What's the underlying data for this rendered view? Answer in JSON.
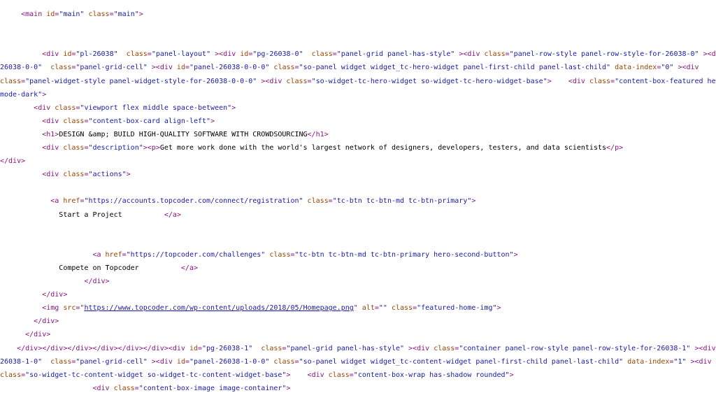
{
  "lines": [
    {
      "indent": "     ",
      "parts": [
        {
          "c": "tag",
          "t": "<main "
        },
        {
          "c": "attr",
          "t": "id"
        },
        {
          "c": "tag",
          "t": "="
        },
        {
          "c": "val",
          "t": "\"main\""
        },
        {
          "c": "tag",
          "t": " "
        },
        {
          "c": "attr",
          "t": "class"
        },
        {
          "c": "tag",
          "t": "="
        },
        {
          "c": "val",
          "t": "\"main\""
        },
        {
          "c": "tag",
          "t": ">"
        }
      ]
    },
    {
      "indent": "",
      "parts": []
    },
    {
      "indent": "",
      "parts": []
    },
    {
      "indent": "          ",
      "parts": [
        {
          "c": "tag",
          "t": "<div "
        },
        {
          "c": "attr",
          "t": "id"
        },
        {
          "c": "tag",
          "t": "="
        },
        {
          "c": "val",
          "t": "\"pl-26038\""
        },
        {
          "c": "tag",
          "t": "  "
        },
        {
          "c": "attr",
          "t": "class"
        },
        {
          "c": "tag",
          "t": "="
        },
        {
          "c": "val",
          "t": "\"panel-layout\""
        },
        {
          "c": "tag",
          "t": " ><div "
        },
        {
          "c": "attr",
          "t": "id"
        },
        {
          "c": "tag",
          "t": "="
        },
        {
          "c": "val",
          "t": "\"pg-26038-0\""
        },
        {
          "c": "tag",
          "t": "  "
        },
        {
          "c": "attr",
          "t": "class"
        },
        {
          "c": "tag",
          "t": "="
        },
        {
          "c": "val",
          "t": "\"panel-grid panel-has-style\""
        },
        {
          "c": "tag",
          "t": " ><div "
        },
        {
          "c": "attr",
          "t": "class"
        },
        {
          "c": "tag",
          "t": "="
        },
        {
          "c": "val",
          "t": "\"panel-row-style panel-row-style-for-26038-0\""
        },
        {
          "c": "tag",
          "t": " ><div "
        },
        {
          "c": "attr",
          "t": "id"
        },
        {
          "c": "tag",
          "t": "="
        },
        {
          "c": "val",
          "t": "\"pgc-"
        }
      ]
    },
    {
      "indent": "",
      "parts": [
        {
          "c": "val",
          "t": "26038-0-0\""
        },
        {
          "c": "tag",
          "t": "  "
        },
        {
          "c": "attr",
          "t": "class"
        },
        {
          "c": "tag",
          "t": "="
        },
        {
          "c": "val",
          "t": "\"panel-grid-cell\""
        },
        {
          "c": "tag",
          "t": " ><div "
        },
        {
          "c": "attr",
          "t": "id"
        },
        {
          "c": "tag",
          "t": "="
        },
        {
          "c": "val",
          "t": "\"panel-26038-0-0-0\""
        },
        {
          "c": "tag",
          "t": " "
        },
        {
          "c": "attr",
          "t": "class"
        },
        {
          "c": "tag",
          "t": "="
        },
        {
          "c": "val",
          "t": "\"so-panel widget widget_tc-hero-widget panel-first-child panel-last-child\""
        },
        {
          "c": "tag",
          "t": " "
        },
        {
          "c": "attr",
          "t": "data-index"
        },
        {
          "c": "tag",
          "t": "="
        },
        {
          "c": "val",
          "t": "\"0\""
        },
        {
          "c": "tag",
          "t": " ><div"
        }
      ]
    },
    {
      "indent": "",
      "parts": [
        {
          "c": "attr",
          "t": "class"
        },
        {
          "c": "tag",
          "t": "="
        },
        {
          "c": "val",
          "t": "\"panel-widget-style panel-widget-style-for-26038-0-0-0\""
        },
        {
          "c": "tag",
          "t": " ><div "
        },
        {
          "c": "attr",
          "t": "class"
        },
        {
          "c": "tag",
          "t": "="
        },
        {
          "c": "val",
          "t": "\"so-widget-tc-hero-widget so-widget-tc-hero-widget-base\""
        },
        {
          "c": "tag",
          "t": ">"
        },
        {
          "c": "txt",
          "t": "    "
        },
        {
          "c": "tag",
          "t": "<div "
        },
        {
          "c": "attr",
          "t": "class"
        },
        {
          "c": "tag",
          "t": "="
        },
        {
          "c": "val",
          "t": "\"content-box-featured hero bg-"
        }
      ]
    },
    {
      "indent": "",
      "parts": [
        {
          "c": "val",
          "t": "mode-dark\""
        },
        {
          "c": "tag",
          "t": ">"
        }
      ]
    },
    {
      "indent": "        ",
      "parts": [
        {
          "c": "tag",
          "t": "<div "
        },
        {
          "c": "attr",
          "t": "class"
        },
        {
          "c": "tag",
          "t": "="
        },
        {
          "c": "val",
          "t": "\"viewport flex middle space-between\""
        },
        {
          "c": "tag",
          "t": ">"
        }
      ]
    },
    {
      "indent": "          ",
      "parts": [
        {
          "c": "tag",
          "t": "<div "
        },
        {
          "c": "attr",
          "t": "class"
        },
        {
          "c": "tag",
          "t": "="
        },
        {
          "c": "val",
          "t": "\"content-box-card align-left\""
        },
        {
          "c": "tag",
          "t": ">"
        }
      ]
    },
    {
      "indent": "          ",
      "parts": [
        {
          "c": "tag",
          "t": "<h1>"
        },
        {
          "c": "txt",
          "t": "DESIGN &amp; BUILD HIGH-QUALITY SOFTWARE WITH CROWDSOURCING"
        },
        {
          "c": "tag",
          "t": "</h1>"
        }
      ]
    },
    {
      "indent": "          ",
      "parts": [
        {
          "c": "tag",
          "t": "<div "
        },
        {
          "c": "attr",
          "t": "class"
        },
        {
          "c": "tag",
          "t": "="
        },
        {
          "c": "val",
          "t": "\"description\""
        },
        {
          "c": "tag",
          "t": "><p>"
        },
        {
          "c": "txt",
          "t": "Get more work done with the world's largest network of designers, developers, testers, and data scientists"
        },
        {
          "c": "tag",
          "t": "</p>"
        }
      ]
    },
    {
      "indent": "",
      "parts": [
        {
          "c": "tag",
          "t": "</div>"
        }
      ]
    },
    {
      "indent": "          ",
      "parts": [
        {
          "c": "tag",
          "t": "<div "
        },
        {
          "c": "attr",
          "t": "class"
        },
        {
          "c": "tag",
          "t": "="
        },
        {
          "c": "val",
          "t": "\"actions\""
        },
        {
          "c": "tag",
          "t": ">"
        }
      ]
    },
    {
      "indent": "",
      "parts": []
    },
    {
      "indent": "            ",
      "parts": [
        {
          "c": "tag",
          "t": "<a "
        },
        {
          "c": "attr",
          "t": "href"
        },
        {
          "c": "tag",
          "t": "="
        },
        {
          "c": "val",
          "t": "\"https://accounts.topcoder.com/connect/registration\""
        },
        {
          "c": "tag",
          "t": " "
        },
        {
          "c": "attr",
          "t": "class"
        },
        {
          "c": "tag",
          "t": "="
        },
        {
          "c": "val",
          "t": "\"tc-btn tc-btn-md tc-btn-primary\""
        },
        {
          "c": "tag",
          "t": ">"
        }
      ]
    },
    {
      "indent": "              ",
      "parts": [
        {
          "c": "txt",
          "t": "Start a Project          "
        },
        {
          "c": "tag",
          "t": "</a>"
        }
      ]
    },
    {
      "indent": "",
      "parts": []
    },
    {
      "indent": "",
      "parts": []
    },
    {
      "indent": "                      ",
      "parts": [
        {
          "c": "tag",
          "t": "<a "
        },
        {
          "c": "attr",
          "t": "href"
        },
        {
          "c": "tag",
          "t": "="
        },
        {
          "c": "val",
          "t": "\"https://topcoder.com/challenges\""
        },
        {
          "c": "tag",
          "t": " "
        },
        {
          "c": "attr",
          "t": "class"
        },
        {
          "c": "tag",
          "t": "="
        },
        {
          "c": "val",
          "t": "\"tc-btn tc-btn-md tc-btn-primary hero-second-button\""
        },
        {
          "c": "tag",
          "t": ">"
        }
      ]
    },
    {
      "indent": "              ",
      "parts": [
        {
          "c": "txt",
          "t": "Compete on Topcoder          "
        },
        {
          "c": "tag",
          "t": "</a>"
        }
      ]
    },
    {
      "indent": "                    ",
      "parts": [
        {
          "c": "tag",
          "t": "</div>"
        }
      ]
    },
    {
      "indent": "          ",
      "parts": [
        {
          "c": "tag",
          "t": "</div>"
        }
      ]
    },
    {
      "indent": "          ",
      "parts": [
        {
          "c": "tag",
          "t": "<img "
        },
        {
          "c": "attr",
          "t": "src"
        },
        {
          "c": "tag",
          "t": "=\""
        },
        {
          "c": "link",
          "t": "https://www.topcoder.com/wp-content/uploads/2018/05/Homepage.png"
        },
        {
          "c": "tag",
          "t": "\" "
        },
        {
          "c": "attr",
          "t": "alt"
        },
        {
          "c": "tag",
          "t": "="
        },
        {
          "c": "val",
          "t": "\"\""
        },
        {
          "c": "tag",
          "t": " "
        },
        {
          "c": "attr",
          "t": "class"
        },
        {
          "c": "tag",
          "t": "="
        },
        {
          "c": "val",
          "t": "\"featured-home-img\""
        },
        {
          "c": "tag",
          "t": ">"
        }
      ]
    },
    {
      "indent": "        ",
      "parts": [
        {
          "c": "tag",
          "t": "</div>"
        }
      ]
    },
    {
      "indent": "      ",
      "parts": [
        {
          "c": "tag",
          "t": "</div>"
        }
      ]
    },
    {
      "indent": "    ",
      "parts": [
        {
          "c": "tag",
          "t": "</div></div></div></div></div></div><div "
        },
        {
          "c": "attr",
          "t": "id"
        },
        {
          "c": "tag",
          "t": "="
        },
        {
          "c": "val",
          "t": "\"pg-26038-1\""
        },
        {
          "c": "tag",
          "t": "  "
        },
        {
          "c": "attr",
          "t": "class"
        },
        {
          "c": "tag",
          "t": "="
        },
        {
          "c": "val",
          "t": "\"panel-grid panel-has-style\""
        },
        {
          "c": "tag",
          "t": " ><div "
        },
        {
          "c": "attr",
          "t": "class"
        },
        {
          "c": "tag",
          "t": "="
        },
        {
          "c": "val",
          "t": "\"container panel-row-style panel-row-style-for-26038-1\""
        },
        {
          "c": "tag",
          "t": " ><div "
        },
        {
          "c": "attr",
          "t": "id"
        },
        {
          "c": "tag",
          "t": "="
        },
        {
          "c": "val",
          "t": "\"pgc-"
        }
      ]
    },
    {
      "indent": "",
      "parts": [
        {
          "c": "val",
          "t": "26038-1-0\""
        },
        {
          "c": "tag",
          "t": "  "
        },
        {
          "c": "attr",
          "t": "class"
        },
        {
          "c": "tag",
          "t": "="
        },
        {
          "c": "val",
          "t": "\"panel-grid-cell\""
        },
        {
          "c": "tag",
          "t": " ><div "
        },
        {
          "c": "attr",
          "t": "id"
        },
        {
          "c": "tag",
          "t": "="
        },
        {
          "c": "val",
          "t": "\"panel-26038-1-0-0\""
        },
        {
          "c": "tag",
          "t": " "
        },
        {
          "c": "attr",
          "t": "class"
        },
        {
          "c": "tag",
          "t": "="
        },
        {
          "c": "val",
          "t": "\"so-panel widget widget_tc-content-widget panel-first-child panel-last-child\""
        },
        {
          "c": "tag",
          "t": " "
        },
        {
          "c": "attr",
          "t": "data-index"
        },
        {
          "c": "tag",
          "t": "="
        },
        {
          "c": "val",
          "t": "\"1\""
        },
        {
          "c": "tag",
          "t": " ><div"
        }
      ]
    },
    {
      "indent": "",
      "parts": [
        {
          "c": "attr",
          "t": "class"
        },
        {
          "c": "tag",
          "t": "="
        },
        {
          "c": "val",
          "t": "\"so-widget-tc-content-widget so-widget-tc-content-widget-base\""
        },
        {
          "c": "tag",
          "t": ">"
        },
        {
          "c": "txt",
          "t": "    "
        },
        {
          "c": "tag",
          "t": "<div "
        },
        {
          "c": "attr",
          "t": "class"
        },
        {
          "c": "tag",
          "t": "="
        },
        {
          "c": "val",
          "t": "\"content-box-wrap has-shadow rounded\""
        },
        {
          "c": "tag",
          "t": ">"
        }
      ]
    },
    {
      "indent": "                      ",
      "parts": [
        {
          "c": "tag",
          "t": "<div "
        },
        {
          "c": "attr",
          "t": "class"
        },
        {
          "c": "tag",
          "t": "="
        },
        {
          "c": "val",
          "t": "\"content-box-image image-container\""
        },
        {
          "c": "tag",
          "t": ">"
        }
      ]
    }
  ]
}
